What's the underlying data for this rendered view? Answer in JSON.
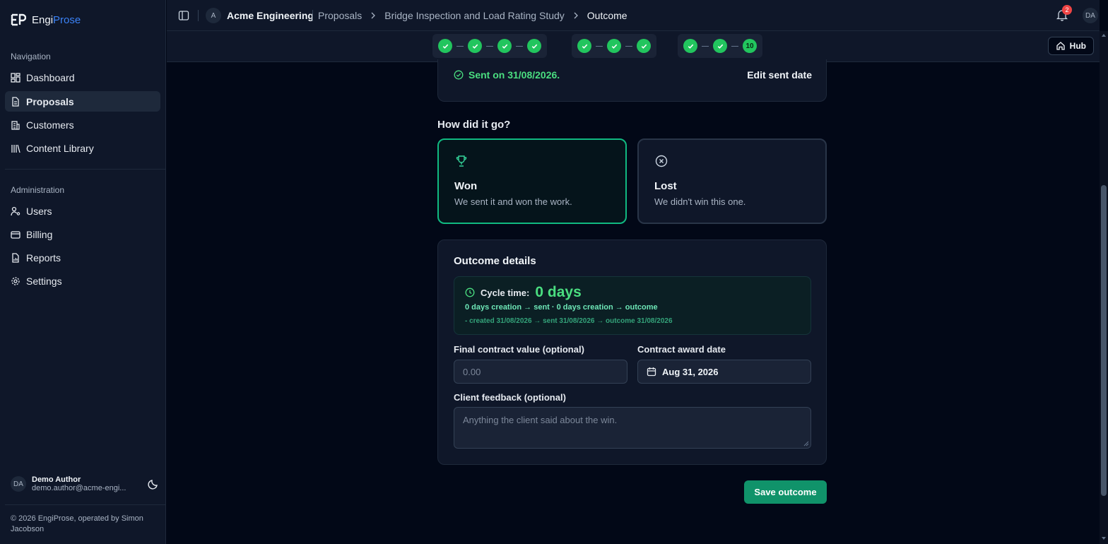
{
  "brand": {
    "name_part1": "Engi",
    "name_part2": "Prose"
  },
  "sidebar": {
    "navigation_label": "Navigation",
    "nav_items": [
      {
        "label": "Dashboard",
        "icon": "dashboard-icon"
      },
      {
        "label": "Proposals",
        "icon": "file-text-icon",
        "active": true
      },
      {
        "label": "Customers",
        "icon": "building-icon"
      },
      {
        "label": "Content Library",
        "icon": "library-icon"
      }
    ],
    "admin_label": "Administration",
    "admin_items": [
      {
        "label": "Users",
        "icon": "user-cog-icon"
      },
      {
        "label": "Billing",
        "icon": "credit-card-icon"
      },
      {
        "label": "Reports",
        "icon": "report-icon"
      },
      {
        "label": "Settings",
        "icon": "gear-icon"
      }
    ],
    "user": {
      "initials": "DA",
      "name": "Demo Author",
      "email": "demo.author@acme-engi..."
    },
    "copyright": "© 2026 EngiProse, operated by Simon Jacobson"
  },
  "topbar": {
    "org_initial": "A",
    "org_name": "Acme Engineering",
    "breadcrumbs": [
      "Proposals",
      "Bridge Inspection and Load Rating Study",
      "Outcome"
    ],
    "notification_count": "2",
    "user_initials": "DA"
  },
  "stepper": {
    "groups": [
      {
        "steps": [
          "done",
          "done",
          "done",
          "done"
        ]
      },
      {
        "steps": [
          "done",
          "done",
          "done"
        ]
      },
      {
        "steps": [
          "done",
          "done",
          "10"
        ]
      }
    ],
    "hub_label": "Hub"
  },
  "sent": {
    "status": "Sent on 31/08/2026.",
    "edit_label": "Edit sent date"
  },
  "outcome": {
    "question": "How did it go?",
    "won": {
      "title": "Won",
      "description": "We sent it and won the work.",
      "selected": true
    },
    "lost": {
      "title": "Lost",
      "description": "We didn't win this one."
    }
  },
  "details": {
    "title": "Outcome details",
    "cycle_label": "Cycle time:",
    "cycle_value": "0 days",
    "cycle_line1": "0 days creation → sent · 0 days creation → outcome",
    "cycle_line2": "- created 31/08/2026 → sent 31/08/2026 → outcome 31/08/2026",
    "contract_value_label": "Final contract value (optional)",
    "contract_value_placeholder": "0.00",
    "award_date_label": "Contract award date",
    "award_date_value": "Aug 31, 2026",
    "feedback_label": "Client feedback (optional)",
    "feedback_placeholder": "Anything the client said about the win."
  },
  "save_label": "Save outcome",
  "colors": {
    "accent_green": "#10b981",
    "success_text": "#4ade80",
    "brand_blue": "#3b82f6",
    "badge_red": "#ef4444"
  }
}
